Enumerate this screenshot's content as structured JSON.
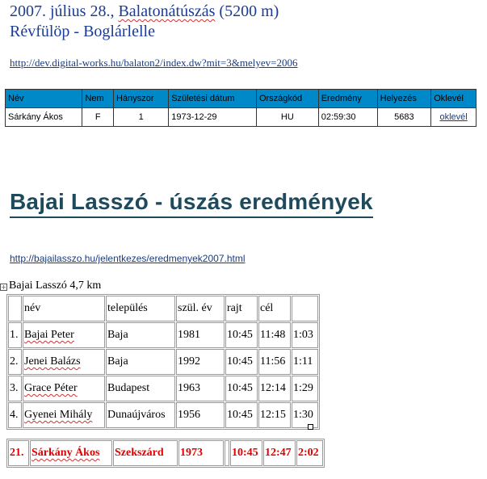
{
  "swim1": {
    "title_date": "2007. július 28.,",
    "title_event": "Balatonátúszás",
    "title_distance": "(5200 m)",
    "route": "Révfülöp - Boglárlelle",
    "link": "http://dev.digital-works.hu/balaton2/index.dw?mit=3&melyev=2006",
    "headers": [
      "Név",
      "Nem",
      "Hányszor",
      "Születési dátum",
      "Országkód",
      "Eredmény",
      "Helyezés",
      "Oklevél"
    ],
    "row": {
      "name": "Sárkány Ákos",
      "sex": "F",
      "times": "1",
      "birth": "1973-12-29",
      "country": "HU",
      "result": "02:59:30",
      "rank": "5683",
      "certificate": "oklevél"
    }
  },
  "swim2": {
    "heading": "Bajai Lasszó - úszás eredmények",
    "link": "http://bajailasszo.hu/jelentkezes/eredmenyek2007.html",
    "subtitle": "Bajai Lasszó 4,7 km",
    "headers": [
      "",
      "név",
      "település",
      "szül. év",
      "rajt",
      "cél",
      ""
    ],
    "rows": [
      {
        "rank": "1.",
        "name": "Bajai Peter",
        "town": "Baja",
        "year": "1981",
        "start": "10:45",
        "finish": "11:48",
        "time": "1:03"
      },
      {
        "rank": "2.",
        "name": "Jenei Balázs",
        "town": "Baja",
        "year": "1992",
        "start": "10:45",
        "finish": "11:56",
        "time": "1:11"
      },
      {
        "rank": "3.",
        "name": "Grace Péter",
        "town": "Budapest",
        "year": "1963",
        "start": "10:45",
        "finish": "12:14",
        "time": "1:29"
      },
      {
        "rank": "4.",
        "name": "Gyenei Mihály",
        "town": "Dunaújváros",
        "year": "1956",
        "start": "10:45",
        "finish": "12:15",
        "time": "1:30"
      }
    ],
    "highlight": {
      "rank": "21.",
      "name": "Sárkány Ákos",
      "town": "Szekszárd",
      "year": "1973",
      "start": "10:45",
      "finish": "12:47",
      "time": "2:02"
    }
  },
  "colors": {
    "title": "#1a3c96",
    "header_bg": "#0089c9",
    "heading": "#1f4a5c",
    "highlight": "#e00000"
  }
}
